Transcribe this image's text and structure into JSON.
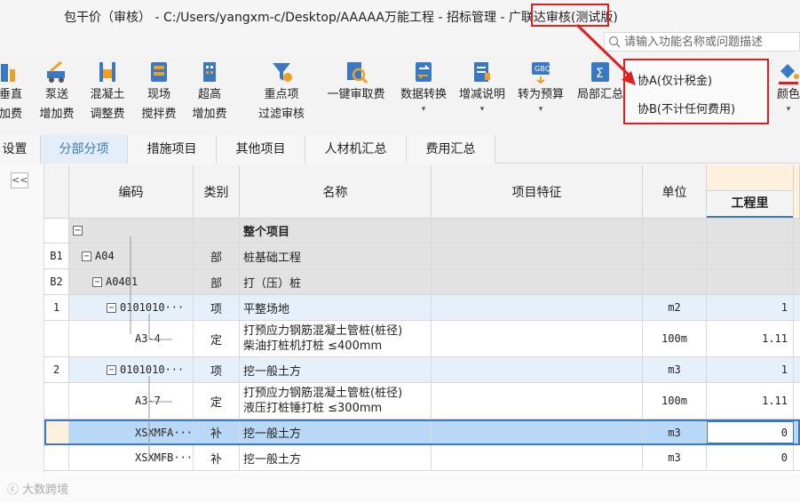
{
  "window": {
    "title": "包干价（审核） - C:/Users/yangxm-c/Desktop/AAAAA万能工程 - 招标管理 - 广联达审核(测试版)",
    "highlight_text": "广联达审核"
  },
  "search": {
    "placeholder": "请输入功能名称或问题描述"
  },
  "toolbar": {
    "items": [
      {
        "label1": "垂直",
        "label2": "加费"
      },
      {
        "label1": "泵送",
        "label2": "增加费"
      },
      {
        "label1": "混凝土",
        "label2": "调整费"
      },
      {
        "label1": "现场",
        "label2": "搅拌费"
      },
      {
        "label1": "超高",
        "label2": "增加费"
      },
      {
        "label1": "重点项",
        "label2": "过滤审核"
      },
      {
        "label1": "一键审取费"
      },
      {
        "label1": "数据转换",
        "caret": "▾"
      },
      {
        "label1": "增减说明",
        "caret": "▾"
      },
      {
        "label1": "转为预算",
        "caret": "▾"
      },
      {
        "label1": "局部汇总"
      },
      {
        "label1": "颜色",
        "caret": "▾"
      }
    ]
  },
  "dropdown": {
    "items": [
      "协A(仅计税金)",
      "协B(不计任何费用)"
    ]
  },
  "tabs": [
    "设置",
    "分部分项",
    "措施项目",
    "其他项目",
    "人材机汇总",
    "费用汇总"
  ],
  "left_panel": {
    "collapse_label": "<<"
  },
  "table": {
    "headers": [
      "编码",
      "类别",
      "名称",
      "项目特征",
      "单位",
      "工程里"
    ],
    "rows": [
      {
        "no": "",
        "code": "",
        "type": "",
        "name": "整个项目",
        "feature": "",
        "unit": "",
        "qty": ""
      },
      {
        "no": "B1",
        "code": "A04",
        "type": "部",
        "name": "桩基础工程",
        "feature": "",
        "unit": "",
        "qty": ""
      },
      {
        "no": "B2",
        "code": "A0401",
        "type": "部",
        "name": "打（压）桩",
        "feature": "",
        "unit": "",
        "qty": ""
      },
      {
        "no": "1",
        "code": "0101010···",
        "type": "项",
        "name": "平整场地",
        "feature": "",
        "unit": "m2",
        "qty": "1"
      },
      {
        "no": "",
        "code": "A3-4",
        "type": "定",
        "name": "打预应力钢筋混凝土管桩(桩径)",
        "name2": "柴油打桩机打桩 ≤400mm",
        "feature": "",
        "unit": "100m",
        "qty": "1.11"
      },
      {
        "no": "2",
        "code": "0101010···",
        "type": "项",
        "name": "挖一般土方",
        "feature": "",
        "unit": "m3",
        "qty": "1"
      },
      {
        "no": "",
        "code": "A3-7",
        "type": "定",
        "name": "打预应力钢筋混凝土管桩(桩径)",
        "name2": "液压打桩锤打桩 ≤300mm",
        "feature": "",
        "unit": "100m",
        "qty": "1.11"
      },
      {
        "no": "",
        "code": "XSXMFA···",
        "type": "补",
        "name": "挖一般土方",
        "feature": "",
        "unit": "m3",
        "qty": "0"
      },
      {
        "no": "",
        "code": "XSXMFB···",
        "type": "补",
        "name": "挖一般土方",
        "feature": "",
        "unit": "m3",
        "qty": "0"
      }
    ]
  },
  "watermark": "大数跨境",
  "colors": {
    "accent": "#3b78c4",
    "highlight_red": "#e02020",
    "selected_row": "#b9d7f7",
    "group_row": "#e2e2e2",
    "item_row": "#e6f0fb"
  }
}
